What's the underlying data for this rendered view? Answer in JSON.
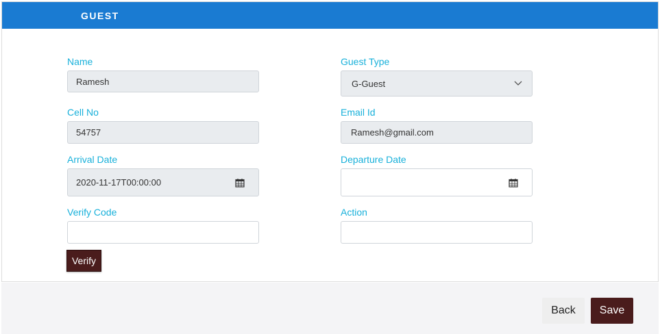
{
  "header": {
    "title": "GUEST"
  },
  "form": {
    "name": {
      "label": "Name",
      "value": "Ramesh"
    },
    "guest_type": {
      "label": "Guest Type",
      "value": "G-Guest"
    },
    "cell_no": {
      "label": "Cell No",
      "value": "54757"
    },
    "email": {
      "label": "Email Id",
      "value": "Ramesh@gmail.com"
    },
    "arrival_date": {
      "label": "Arrival Date",
      "value": "2020-11-17T00:00:00"
    },
    "departure_date": {
      "label": "Departure Date",
      "value": ""
    },
    "verify_code": {
      "label": "Verify Code",
      "value": ""
    },
    "action": {
      "label": "Action",
      "value": ""
    },
    "verify_label": "Verify"
  },
  "footer": {
    "back_label": "Back",
    "save_label": "Save"
  },
  "colors": {
    "header_bg": "#1a7bd2",
    "label": "#17b0da",
    "primary_button": "#4a1c1c",
    "readonly_bg": "#e9ecef"
  },
  "icons": [
    "calendar-icon",
    "chevron-down-icon"
  ]
}
